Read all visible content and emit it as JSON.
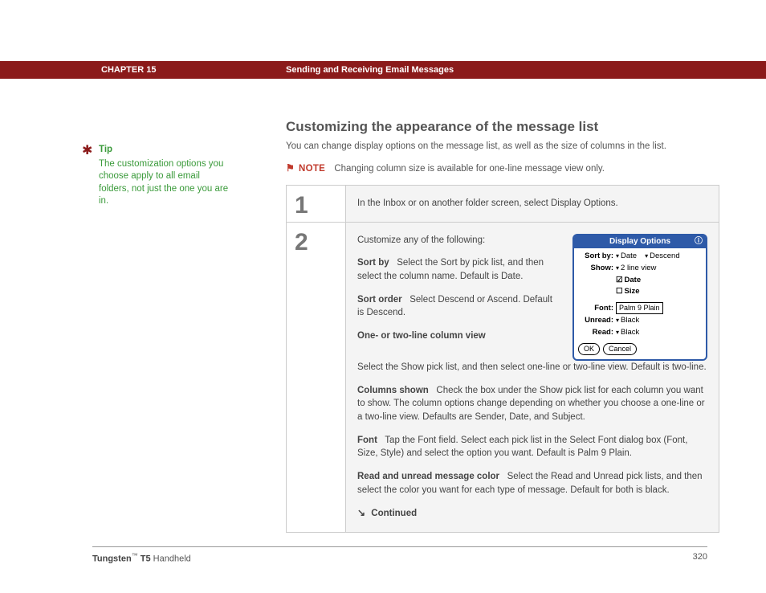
{
  "header": {
    "chapter": "CHAPTER 15",
    "title": "Sending and Receiving Email Messages"
  },
  "tip": {
    "label": "Tip",
    "text": "The customization options you choose apply to all email folders, not just the one you are in."
  },
  "main": {
    "heading": "Customizing the appearance of the message list",
    "intro": "You can change display options on the message list, as well as the size of columns in the list.",
    "note_label": "NOTE",
    "note_text": "Changing column size is available for one-line message view only."
  },
  "steps": {
    "s1": {
      "num": "1",
      "text": "In the Inbox or on another folder screen, select Display Options."
    },
    "s2": {
      "num": "2",
      "lead": "Customize any of the following:",
      "sortby": {
        "label": "Sort by",
        "text": "Select the Sort by pick list, and then select the column name. Default is Date."
      },
      "sortorder": {
        "label": "Sort order",
        "text": "Select Descend or Ascend. Default is Descend."
      },
      "lineview": {
        "label": "One- or two-line column view",
        "text": "Select the Show pick list, and then select one-line or two-line view. Default is two-line."
      },
      "columns": {
        "label": "Columns shown",
        "text": "Check the box under the Show pick list for each column you want to show. The column options change depending on whether you choose a one-line or a two-line view. Defaults are Sender, Date, and Subject."
      },
      "font": {
        "label": "Font",
        "text": "Tap the Font field. Select each pick list in the Select Font dialog box (Font, Size, Style) and select the option you want. Default is Palm 9 Plain."
      },
      "readcolor": {
        "label": "Read and unread message color",
        "text": "Select the Read and Unread pick lists, and then select the color you want for each type of message. Default for both is black."
      },
      "continued": "Continued"
    }
  },
  "dialog": {
    "title": "Display Options",
    "sortby_label": "Sort by:",
    "sortby_val": "Date",
    "sortby_order": "Descend",
    "show_label": "Show:",
    "show_val": "2 line view",
    "check_date": "Date",
    "check_size": "Size",
    "font_label": "Font:",
    "font_val": "Palm 9 Plain",
    "unread_label": "Unread:",
    "unread_val": "Black",
    "read_label": "Read:",
    "read_val": "Black",
    "ok": "OK",
    "cancel": "Cancel"
  },
  "footer": {
    "brand": "Tungsten",
    "model": "T5",
    "suffix": "Handheld",
    "page": "320"
  }
}
